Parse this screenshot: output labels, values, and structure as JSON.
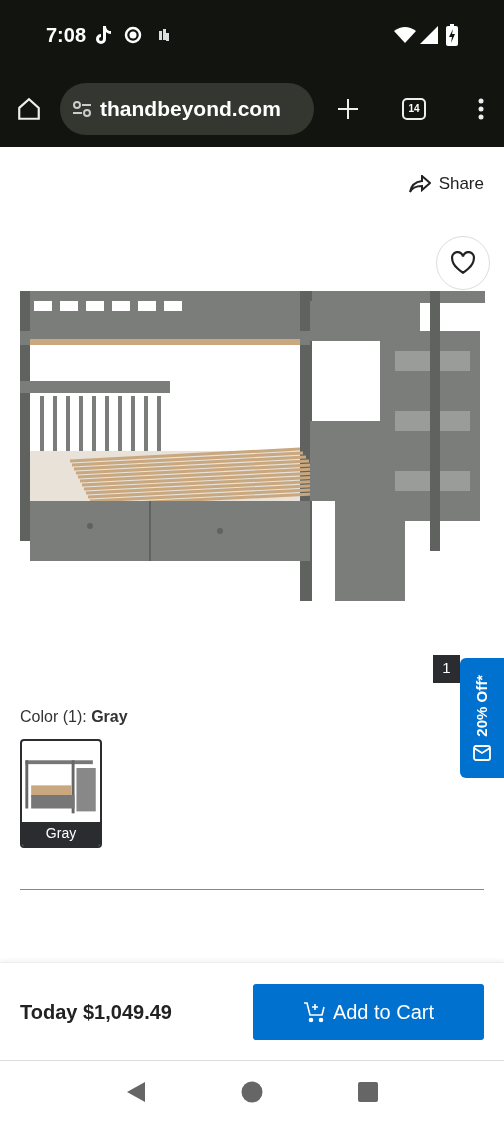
{
  "status_bar": {
    "time": "7:08"
  },
  "browser": {
    "url": "thandbeyond.com",
    "tab_count": "14"
  },
  "share": {
    "label": "Share"
  },
  "gallery": {
    "favorite": false,
    "image_index": "1"
  },
  "promo_tab": {
    "label": "20% Off*"
  },
  "color": {
    "label": "Color (1): ",
    "value": "Gray",
    "swatches": [
      {
        "label": "Gray",
        "selected": true
      }
    ]
  },
  "bottom_bar": {
    "price": "Today $1,049.49",
    "button": "Add to Cart"
  }
}
